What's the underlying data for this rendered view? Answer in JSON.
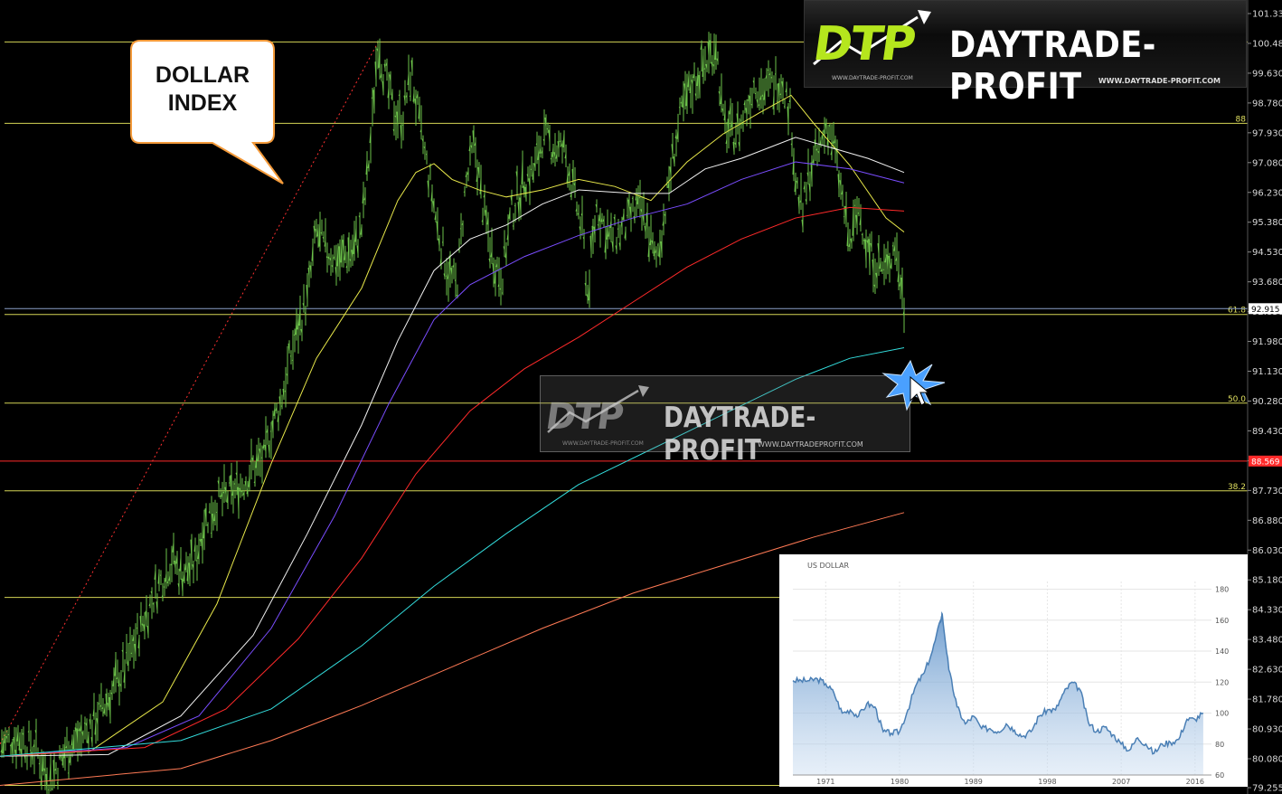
{
  "branding": {
    "logo_mark": "DTP",
    "brand_name": "DAYTRADE-PROFIT",
    "logo_url_small": "WWW.DAYTRADE-PROFIT.COM",
    "logo_url": "WWW.DAYTRADE-PROFIT.COM",
    "watermark_url": "WWW.DAYTRADEPROFIT.COM",
    "watermark_url_small": "WWW.DAYTRADE-PROFIT.COM",
    "accent_color": "#b5e61d"
  },
  "callout": {
    "line1": "DOLLAR",
    "line2": "INDEX"
  },
  "cursor_icon": "arrow-cursor-icon with blue star burst",
  "chart_data": [
    {
      "type": "candlestick",
      "title": "DOLLAR INDEX",
      "ylim": [
        79.0,
        101.5
      ],
      "y_ticks": [
        "101.330",
        "100.480",
        "99.630",
        "98.780",
        "97.930",
        "97.080",
        "96.230",
        "95.380",
        "94.530",
        "93.680",
        "92.830",
        "91.980",
        "91.130",
        "90.280",
        "89.430",
        "88.580",
        "87.730",
        "86.880",
        "86.030",
        "85.180",
        "84.330",
        "83.480",
        "82.630",
        "81.780",
        "80.930",
        "80.080",
        "79.255"
      ],
      "y_tick_values": [
        101.33,
        100.48,
        99.63,
        98.78,
        97.93,
        97.08,
        96.23,
        95.38,
        94.53,
        93.68,
        92.83,
        91.98,
        91.13,
        90.28,
        89.43,
        88.58,
        87.73,
        86.88,
        86.03,
        85.18,
        84.33,
        83.48,
        82.63,
        81.78,
        80.93,
        80.08,
        79.255
      ],
      "current_price": {
        "label": "92.915",
        "value": 92.915,
        "color": "#ffffff"
      },
      "price_marker": {
        "label": "88.569",
        "value": 88.569,
        "color": "#ff2a2a"
      },
      "fib_levels": [
        {
          "label": "",
          "value": 100.52,
          "color": "#d4d455"
        },
        {
          "label": "88",
          "value": 98.2,
          "color": "#d4d455"
        },
        {
          "label": "61.8",
          "value": 92.75,
          "color": "#d4d455"
        },
        {
          "label": "50.0",
          "value": 90.22,
          "color": "#d4d455"
        },
        {
          "label": "38.2",
          "value": 87.72,
          "color": "#d4d455"
        },
        {
          "label": "",
          "value": 84.68,
          "color": "#d4d455"
        },
        {
          "label": "",
          "value": 79.32,
          "color": "#d4d455"
        }
      ],
      "trend_line": {
        "from": [
          0,
          80.5
        ],
        "to": [
          420,
          100.6
        ],
        "color": "#ff3030"
      },
      "price_bars": [
        [
          0,
          80.5
        ],
        [
          20,
          80.7
        ],
        [
          40,
          80.3
        ],
        [
          55,
          79.5
        ],
        [
          75,
          80.4
        ],
        [
          90,
          80.7
        ],
        [
          100,
          81.0
        ],
        [
          120,
          81.8
        ],
        [
          140,
          82.8
        ],
        [
          160,
          84.1
        ],
        [
          175,
          85.0
        ],
        [
          190,
          85.8
        ],
        [
          200,
          85.4
        ],
        [
          215,
          85.6
        ],
        [
          225,
          86.8
        ],
        [
          240,
          87.4
        ],
        [
          255,
          87.6
        ],
        [
          270,
          88.0
        ],
        [
          280,
          88.4
        ],
        [
          292,
          88.6
        ],
        [
          300,
          89.5
        ],
        [
          310,
          90.2
        ],
        [
          320,
          91.4
        ],
        [
          330,
          92.4
        ],
        [
          340,
          93.2
        ],
        [
          350,
          95.1
        ],
        [
          360,
          94.6
        ],
        [
          375,
          94.3
        ],
        [
          390,
          94.6
        ],
        [
          400,
          95.2
        ],
        [
          410,
          97.6
        ],
        [
          418,
          100.6
        ],
        [
          425,
          99.6
        ],
        [
          435,
          98.6
        ],
        [
          445,
          98.3
        ],
        [
          455,
          99.7
        ],
        [
          465,
          98.0
        ],
        [
          475,
          96.6
        ],
        [
          485,
          95.1
        ],
        [
          495,
          94.0
        ],
        [
          505,
          93.5
        ],
        [
          515,
          96.4
        ],
        [
          525,
          97.6
        ],
        [
          535,
          95.7
        ],
        [
          545,
          94.4
        ],
        [
          555,
          93.8
        ],
        [
          565,
          95.6
        ],
        [
          580,
          96.6
        ],
        [
          590,
          96.8
        ],
        [
          600,
          97.8
        ],
        [
          615,
          97.5
        ],
        [
          625,
          97.4
        ],
        [
          635,
          96.2
        ],
        [
          645,
          95.0
        ],
        [
          650,
          93.3
        ],
        [
          660,
          95.8
        ],
        [
          675,
          94.9
        ],
        [
          690,
          95.2
        ],
        [
          705,
          95.8
        ],
        [
          715,
          95.4
        ],
        [
          725,
          94.2
        ],
        [
          735,
          95.6
        ],
        [
          745,
          97.4
        ],
        [
          755,
          98.6
        ],
        [
          765,
          99.3
        ],
        [
          780,
          99.9
        ],
        [
          792,
          100.5
        ],
        [
          800,
          98.2
        ],
        [
          810,
          97.9
        ],
        [
          820,
          98.2
        ],
        [
          835,
          99.4
        ],
        [
          845,
          99.1
        ],
        [
          855,
          99.3
        ],
        [
          865,
          99.5
        ],
        [
          875,
          98.4
        ],
        [
          880,
          96.6
        ],
        [
          888,
          95.6
        ],
        [
          895,
          96.8
        ],
        [
          905,
          97.3
        ],
        [
          915,
          98.2
        ],
        [
          922,
          97.6
        ],
        [
          930,
          96.3
        ],
        [
          940,
          94.7
        ],
        [
          950,
          95.8
        ],
        [
          960,
          94.6
        ],
        [
          970,
          94.2
        ],
        [
          980,
          94.0
        ],
        [
          990,
          94.8
        ],
        [
          1000,
          93.0
        ]
      ],
      "series": [
        {
          "color": "#e8e84a",
          "values": [
            [
              0,
              80.15
            ],
            [
              100,
              80.3
            ],
            [
              180,
              81.7
            ],
            [
              240,
              84.5
            ],
            [
              300,
              88.5
            ],
            [
              350,
              91.5
            ],
            [
              400,
              93.5
            ],
            [
              440,
              96.0
            ],
            [
              460,
              96.8
            ],
            [
              480,
              97.05
            ],
            [
              500,
              96.6
            ],
            [
              530,
              96.3
            ],
            [
              560,
              96.1
            ],
            [
              600,
              96.3
            ],
            [
              640,
              96.6
            ],
            [
              680,
              96.4
            ],
            [
              720,
              96.0
            ],
            [
              760,
              97.1
            ],
            [
              800,
              97.9
            ],
            [
              840,
              98.5
            ],
            [
              875,
              99.0
            ],
            [
              900,
              98.2
            ],
            [
              940,
              97.0
            ],
            [
              980,
              95.5
            ],
            [
              1000,
              95.1
            ]
          ]
        },
        {
          "color": "#f0f0f0",
          "values": [
            [
              0,
              80.15
            ],
            [
              120,
              80.2
            ],
            [
              200,
              81.3
            ],
            [
              280,
              83.6
            ],
            [
              340,
              86.5
            ],
            [
              400,
              89.6
            ],
            [
              440,
              92.0
            ],
            [
              480,
              94.0
            ],
            [
              520,
              94.9
            ],
            [
              560,
              95.3
            ],
            [
              600,
              95.9
            ],
            [
              640,
              96.3
            ],
            [
              700,
              96.2
            ],
            [
              740,
              96.2
            ],
            [
              780,
              96.9
            ],
            [
              820,
              97.2
            ],
            [
              860,
              97.6
            ],
            [
              880,
              97.8
            ],
            [
              920,
              97.5
            ],
            [
              960,
              97.2
            ],
            [
              1000,
              96.8
            ]
          ]
        },
        {
          "color": "#7a4dff",
          "values": [
            [
              0,
              80.15
            ],
            [
              140,
              80.4
            ],
            [
              220,
              81.3
            ],
            [
              300,
              83.8
            ],
            [
              370,
              87.0
            ],
            [
              430,
              90.2
            ],
            [
              480,
              92.6
            ],
            [
              520,
              93.6
            ],
            [
              580,
              94.4
            ],
            [
              640,
              95.0
            ],
            [
              700,
              95.5
            ],
            [
              760,
              95.9
            ],
            [
              820,
              96.6
            ],
            [
              880,
              97.1
            ],
            [
              940,
              96.9
            ],
            [
              1000,
              96.5
            ]
          ]
        },
        {
          "color": "#ff2a2a",
          "values": [
            [
              0,
              80.15
            ],
            [
              160,
              80.4
            ],
            [
              250,
              81.5
            ],
            [
              330,
              83.5
            ],
            [
              400,
              85.8
            ],
            [
              460,
              88.2
            ],
            [
              520,
              90.0
            ],
            [
              580,
              91.2
            ],
            [
              640,
              92.1
            ],
            [
              700,
              93.1
            ],
            [
              760,
              94.1
            ],
            [
              820,
              94.9
            ],
            [
              880,
              95.5
            ],
            [
              940,
              95.8
            ],
            [
              1000,
              95.7
            ]
          ]
        },
        {
          "color": "#33dddd",
          "values": [
            [
              0,
              80.15
            ],
            [
              200,
              80.6
            ],
            [
              300,
              81.5
            ],
            [
              400,
              83.3
            ],
            [
              480,
              85.0
            ],
            [
              560,
              86.5
            ],
            [
              640,
              87.9
            ],
            [
              720,
              88.9
            ],
            [
              800,
              89.9
            ],
            [
              880,
              90.9
            ],
            [
              940,
              91.5
            ],
            [
              1000,
              91.8
            ]
          ]
        },
        {
          "color": "#ff7a55",
          "values": [
            [
              0,
              79.32
            ],
            [
              200,
              79.8
            ],
            [
              300,
              80.6
            ],
            [
              400,
              81.6
            ],
            [
              500,
              82.7
            ],
            [
              600,
              83.8
            ],
            [
              700,
              84.8
            ],
            [
              800,
              85.6
            ],
            [
              900,
              86.4
            ],
            [
              1000,
              87.1
            ]
          ]
        }
      ]
    },
    {
      "type": "area",
      "title": "US DOLLAR",
      "x_ticks": [
        "1971",
        "1980",
        "1989",
        "1998",
        "2007",
        "2016"
      ],
      "y_ticks": [
        "180",
        "160",
        "140",
        "120",
        "100",
        "80",
        "60"
      ],
      "ylim": [
        60,
        185
      ],
      "xlim": [
        1967,
        2018
      ],
      "color": "#4a7fb5",
      "x": [
        1967,
        1968,
        1969,
        1970,
        1971,
        1972,
        1973,
        1974,
        1975,
        1976,
        1977,
        1978,
        1979,
        1980,
        1981,
        1982,
        1983,
        1984,
        1985,
        1985.2,
        1986,
        1987,
        1988,
        1989,
        1990,
        1991,
        1992,
        1993,
        1994,
        1995,
        1996,
        1997,
        1998,
        1999,
        2000,
        2001,
        2002,
        2003,
        2004,
        2005,
        2006,
        2007,
        2008,
        2009,
        2010,
        2011,
        2012,
        2013,
        2014,
        2015,
        2016,
        2017
      ],
      "values": [
        121,
        121,
        121,
        122,
        119,
        113,
        100,
        102,
        98,
        106,
        104,
        88,
        87,
        88,
        102,
        118,
        126,
        140,
        160,
        164,
        128,
        104,
        93,
        98,
        90,
        90,
        88,
        93,
        89,
        85,
        88,
        98,
        102,
        102,
        113,
        120,
        115,
        94,
        88,
        91,
        86,
        80,
        76,
        84,
        80,
        74,
        80,
        81,
        83,
        96,
        96,
        100
      ]
    }
  ]
}
